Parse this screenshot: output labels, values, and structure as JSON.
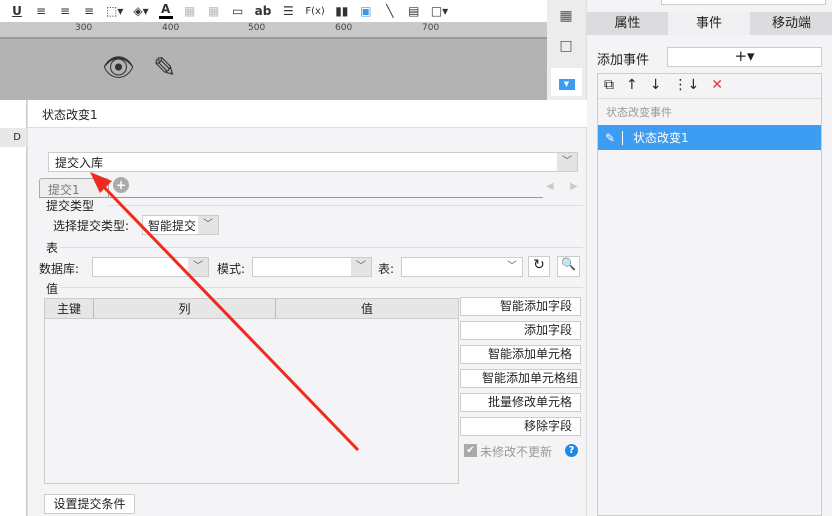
{
  "toolbar": {
    "icons": [
      "underline-icon",
      "align-left-icon",
      "align-center-icon",
      "align-right-icon",
      "border-icon",
      "fill-color-icon",
      "font-color-icon",
      "merge-icon",
      "grid-icon",
      "textbox-icon",
      "text-ab-icon",
      "list-icon",
      "formula-icon",
      "chart-icon",
      "image-icon",
      "line-icon",
      "form-icon",
      "frame-icon"
    ],
    "underline": "U",
    "ab": "ab",
    "fx": "F(x)",
    "font_a": "A"
  },
  "ruler": {
    "ticks": [
      "300",
      "400",
      "500",
      "600",
      "700"
    ]
  },
  "spreadsheet": {
    "column": "D"
  },
  "right_panel": {
    "tabs": [
      {
        "label": "属性"
      },
      {
        "label": "事件"
      },
      {
        "label": "移动端"
      }
    ],
    "add_event_label": "添加事件",
    "add_symbol": "+▾",
    "group_label": "状态改变事件",
    "event_item": "状态改变1",
    "accent": "#3d9df2"
  },
  "dialog": {
    "title": "状态改变1",
    "action_select": "提交入库",
    "tab": "提交1",
    "section_submit_type": "提交类型",
    "submit_type_label": "选择提交类型:",
    "submit_type_value": "智能提交",
    "section_table": "表",
    "database_label": "数据库:",
    "database_value": "",
    "schema_label": "模式:",
    "schema_value": "",
    "table_label": "表:",
    "table_value": "",
    "section_value": "值",
    "columns": [
      "主键",
      "列",
      "值"
    ],
    "buttons": [
      "智能添加字段",
      "添加字段",
      "智能添加单元格",
      "智能添加单元格组",
      "批量修改单元格",
      "移除字段"
    ],
    "checkbox_label": "未修改不更新",
    "checkbox_checked": true,
    "condition_button": "设置提交条件"
  }
}
